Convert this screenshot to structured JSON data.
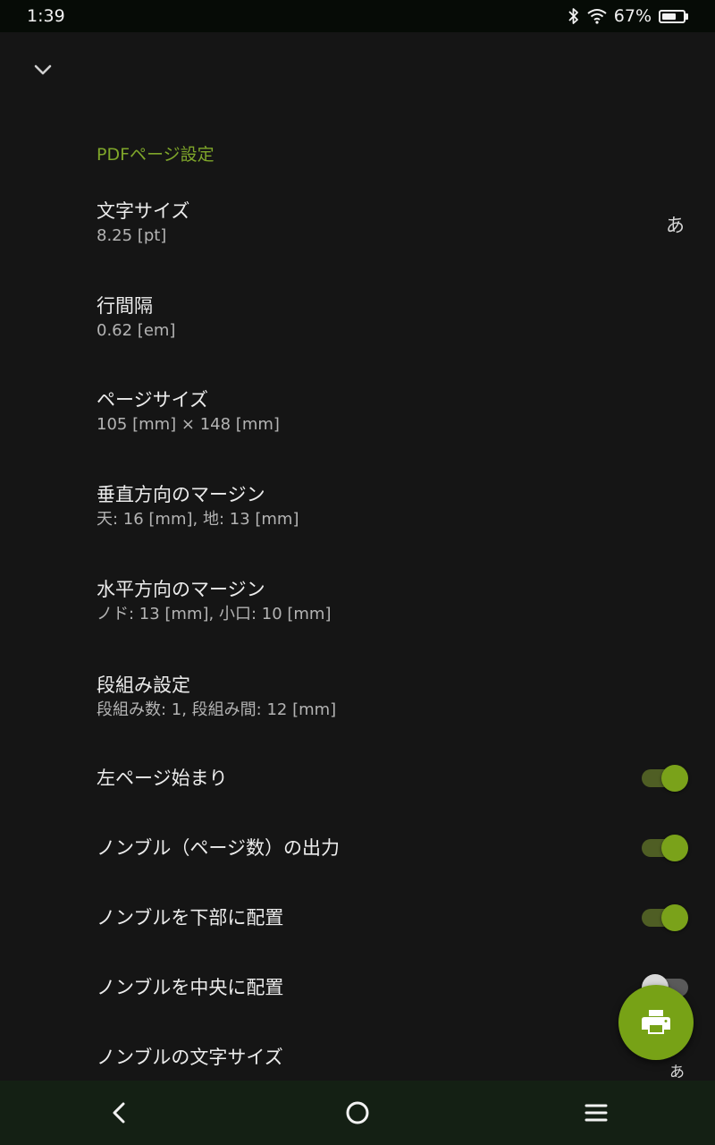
{
  "status_bar": {
    "time": "1:39",
    "battery_percent": "67%",
    "battery_level": 0.67,
    "icons": [
      "bluetooth-icon",
      "wifi-icon",
      "battery-icon"
    ]
  },
  "header": {
    "collapse_icon": "chevron-down-icon"
  },
  "section": {
    "title": "PDFページ設定"
  },
  "settings": [
    {
      "title": "文字サイズ",
      "summary": "8.25 [pt]",
      "glyph": "あ"
    },
    {
      "title": "行間隔",
      "summary": "0.62 [em]"
    },
    {
      "title": "ページサイズ",
      "summary": "105 [mm] × 148 [mm]"
    },
    {
      "title": "垂直方向のマージン",
      "summary": "天: 16 [mm], 地: 13 [mm]"
    },
    {
      "title": "水平方向のマージン",
      "summary": "ノド: 13 [mm], 小口: 10 [mm]"
    },
    {
      "title": "段組み設定",
      "summary": "段組み数: 1, 段組み間: 12 [mm]"
    }
  ],
  "toggles": [
    {
      "title": "左ページ始まり",
      "on": true
    },
    {
      "title": "ノンブル（ページ数）の出力",
      "on": true
    },
    {
      "title": "ノンブルを下部に配置",
      "on": true
    },
    {
      "title": "ノンブルを中央に配置",
      "on": false
    }
  ],
  "last_setting": {
    "title": "ノンブルの文字サイズ",
    "glyph": "あ"
  },
  "fab": {
    "icon": "print-icon",
    "color": "#77a216"
  },
  "nav_bar": {
    "icons": [
      "back-icon",
      "home-icon",
      "menu-icon"
    ]
  },
  "colors": {
    "accent": "#7fa62a",
    "background": "#151515"
  }
}
